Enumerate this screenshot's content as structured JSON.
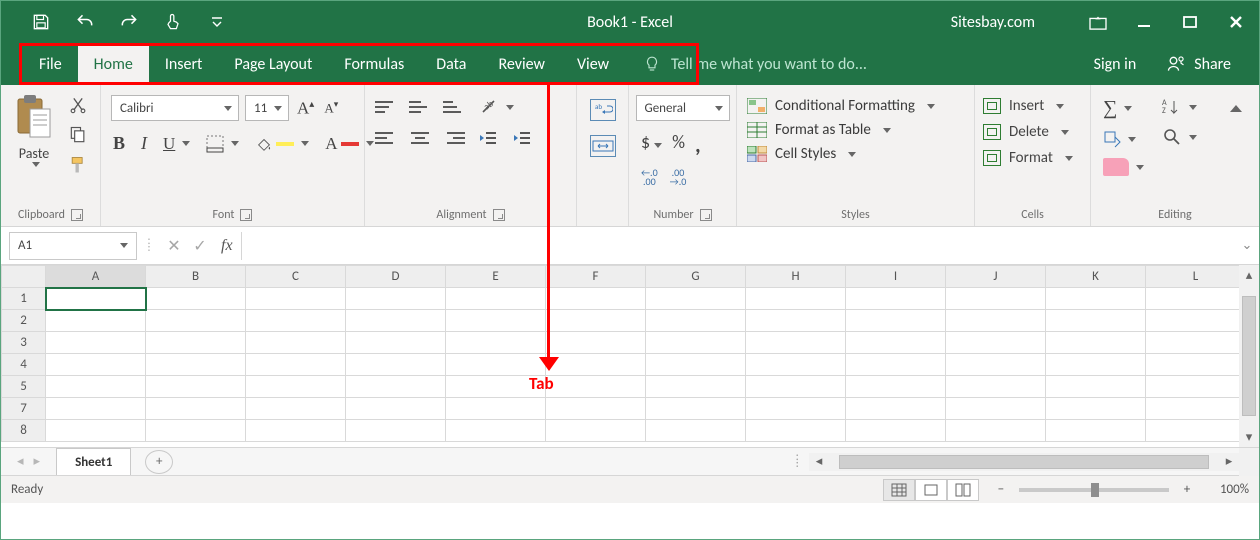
{
  "titlebar": {
    "title": "Book1 - Excel",
    "brand": "Sitesbay.com"
  },
  "tabs": [
    "File",
    "Home",
    "Insert",
    "Page Layout",
    "Formulas",
    "Data",
    "Review",
    "View"
  ],
  "active_tab_index": 1,
  "tellme_placeholder": "Tell me what you want to do...",
  "signin": "Sign in",
  "share": "Share",
  "ribbon": {
    "clipboard": {
      "label": "Clipboard",
      "paste": "Paste"
    },
    "font": {
      "label": "Font",
      "name": "Calibri",
      "size": "11"
    },
    "alignment": {
      "label": "Alignment"
    },
    "number": {
      "label": "Number",
      "format": "General",
      "dec1": ".0\n.00",
      "dec2": ".00\n→.0"
    },
    "styles": {
      "label": "Styles",
      "cond": "Conditional Formatting",
      "table": "Format as Table",
      "cell": "Cell Styles"
    },
    "cells": {
      "label": "Cells",
      "insert": "Insert",
      "delete": "Delete",
      "format": "Format"
    },
    "editing": {
      "label": "Editing"
    }
  },
  "formula_bar": {
    "namebox": "A1",
    "fx": "fx"
  },
  "columns": [
    "A",
    "B",
    "C",
    "D",
    "E",
    "F",
    "G",
    "H",
    "I",
    "J",
    "K",
    "L"
  ],
  "rows": [
    "1",
    "2",
    "3",
    "4",
    "5",
    "7",
    "8"
  ],
  "selected_cell": "A1",
  "annotation": "Tab",
  "sheet_tab": "Sheet1",
  "status": {
    "ready": "Ready",
    "zoom": "100%"
  }
}
